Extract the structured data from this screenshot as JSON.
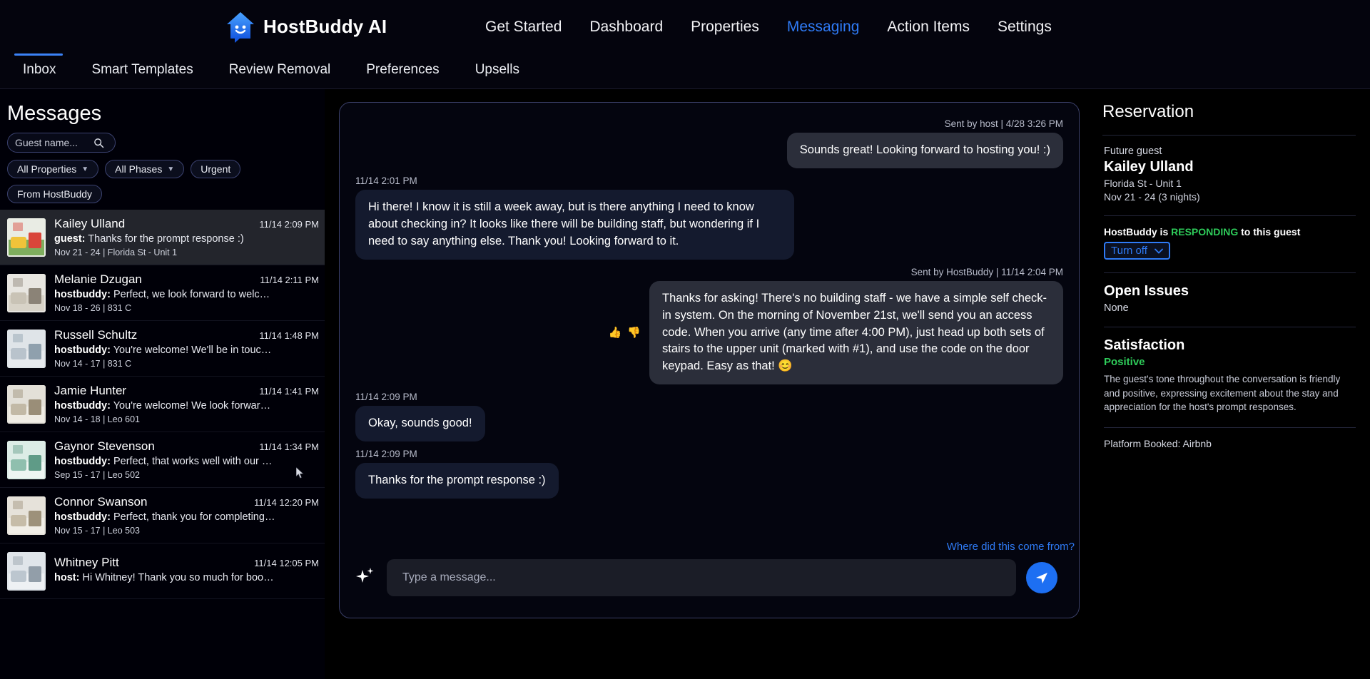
{
  "brand": {
    "name": "HostBuddy AI",
    "logo_icon": "house-smile-icon"
  },
  "main_nav": [
    {
      "label": "Get Started",
      "active": false
    },
    {
      "label": "Dashboard",
      "active": false
    },
    {
      "label": "Properties",
      "active": false
    },
    {
      "label": "Messaging",
      "active": true
    },
    {
      "label": "Action Items",
      "active": false
    },
    {
      "label": "Settings",
      "active": false
    }
  ],
  "sub_nav": [
    {
      "label": "Inbox",
      "active": true
    },
    {
      "label": "Smart Templates",
      "active": false
    },
    {
      "label": "Review Removal",
      "active": false
    },
    {
      "label": "Preferences",
      "active": false
    },
    {
      "label": "Upsells",
      "active": false
    }
  ],
  "left": {
    "title": "Messages",
    "search_placeholder": "Guest name...",
    "search_value": "",
    "search_icon": "search-icon",
    "filters": [
      {
        "label": "All Properties",
        "has_caret": true
      },
      {
        "label": "All Phases",
        "has_caret": true
      },
      {
        "label": "Urgent",
        "has_caret": false
      },
      {
        "label": "From HostBuddy",
        "has_caret": false
      }
    ],
    "conversations": [
      {
        "name": "Kailey Ulland",
        "time": "11/14 2:09 PM",
        "sender": "guest:",
        "snippet": "Thanks for the prompt response :)",
        "meta": "Nov 21 - 24 | Florida St - Unit 1",
        "selected": true
      },
      {
        "name": "Melanie Dzugan",
        "time": "11/14 2:11 PM",
        "sender": "hostbuddy:",
        "snippet": "Perfect, we look forward to welcomi...",
        "meta": "Nov 18 - 26 | 831 C",
        "selected": false
      },
      {
        "name": "Russell Schultz",
        "time": "11/14 1:48 PM",
        "sender": "hostbuddy:",
        "snippet": "You're welcome! We'll be in touch ver...",
        "meta": "Nov 14 - 17 | 831 C",
        "selected": false
      },
      {
        "name": "Jamie Hunter",
        "time": "11/14 1:41 PM",
        "sender": "hostbuddy:",
        "snippet": "You're welcome! We look forward to ...",
        "meta": "Nov 14 - 18 | Leo 601",
        "selected": false
      },
      {
        "name": "Gaynor Stevenson",
        "time": "11/14 1:34 PM",
        "sender": "hostbuddy:",
        "snippet": "Perfect, that works well with our stand...",
        "meta": "Sep 15 - 17 | Leo 502",
        "selected": false
      },
      {
        "name": "Connor Swanson",
        "time": "11/14 12:20 PM",
        "sender": "hostbuddy:",
        "snippet": "Perfect, thank you for completing the...",
        "meta": "Nov 15 - 17 | Leo 503",
        "selected": false
      },
      {
        "name": "Whitney Pitt",
        "time": "11/14 12:05 PM",
        "sender": "host:",
        "snippet": "Hi Whitney! Thank you so much for booking ...",
        "meta": "",
        "selected": false
      }
    ]
  },
  "chat": {
    "messages": [
      {
        "id": "m1",
        "side": "right",
        "style": "host",
        "stamp": "Sent by host | 4/28 3:26 PM",
        "stamp_side": "right",
        "text": "Sounds great! Looking forward to hosting you! :)"
      },
      {
        "id": "m2",
        "side": "left",
        "style": "guest",
        "stamp": "11/14 2:01 PM",
        "stamp_side": "left",
        "text": "Hi there! I know it is still a week away, but is there anything I need to know about checking in? It looks like there will be building staff, but wondering if I need to say anything else. Thank you! Looking forward to it."
      },
      {
        "id": "m3",
        "side": "right",
        "style": "hb",
        "stamp": "Sent by HostBuddy | 11/14 2:04 PM",
        "stamp_side": "right",
        "text": "Thanks for asking! There's no building staff - we have a simple self check-in system. On the morning of November 21st, we'll send you an access code. When you arrive (any time after 4:00 PM), just head up both sets of stairs to the upper unit (marked with #1), and use the code on the door keypad. Easy as that! 😊",
        "reactions": [
          "thumbs-up-icon",
          "thumbs-down-icon"
        ]
      },
      {
        "id": "m4",
        "side": "left",
        "style": "guest",
        "stamp": "11/14 2:09 PM",
        "stamp_side": "left",
        "text": "Okay, sounds good!"
      },
      {
        "id": "m5",
        "side": "left",
        "style": "guest",
        "stamp": "11/14 2:09 PM",
        "stamp_side": "left",
        "text": "Thanks for the prompt response :)"
      }
    ],
    "source_link": "Where did this come from?",
    "composer_placeholder": "Type a message...",
    "composer_value": "",
    "sparkle_icon": "sparkle-icon",
    "send_icon": "send-icon"
  },
  "reservation": {
    "title": "Reservation",
    "guest_label": "Future guest",
    "guest_name": "Kailey Ulland",
    "property": "Florida St - Unit 1",
    "dates": "Nov 21 - 24 (3 nights)",
    "hb_prefix": "HostBuddy is ",
    "hb_status": "RESPONDING",
    "hb_suffix": " to this guest",
    "toggle_label": "Turn off",
    "toggle_caret_icon": "chevron-down-icon",
    "open_issues_title": "Open Issues",
    "open_issues_value": "None",
    "satisfaction_title": "Satisfaction",
    "satisfaction_value": "Positive",
    "satisfaction_desc": "The guest's tone throughout the conversation is friendly and positive, expressing excitement about the stay and appreciation for the host's prompt responses.",
    "platform": "Platform Booked: Airbnb"
  },
  "colors": {
    "accent": "#2f7bf6",
    "positive": "#2ecc5a",
    "selected_row": "#23252c"
  }
}
